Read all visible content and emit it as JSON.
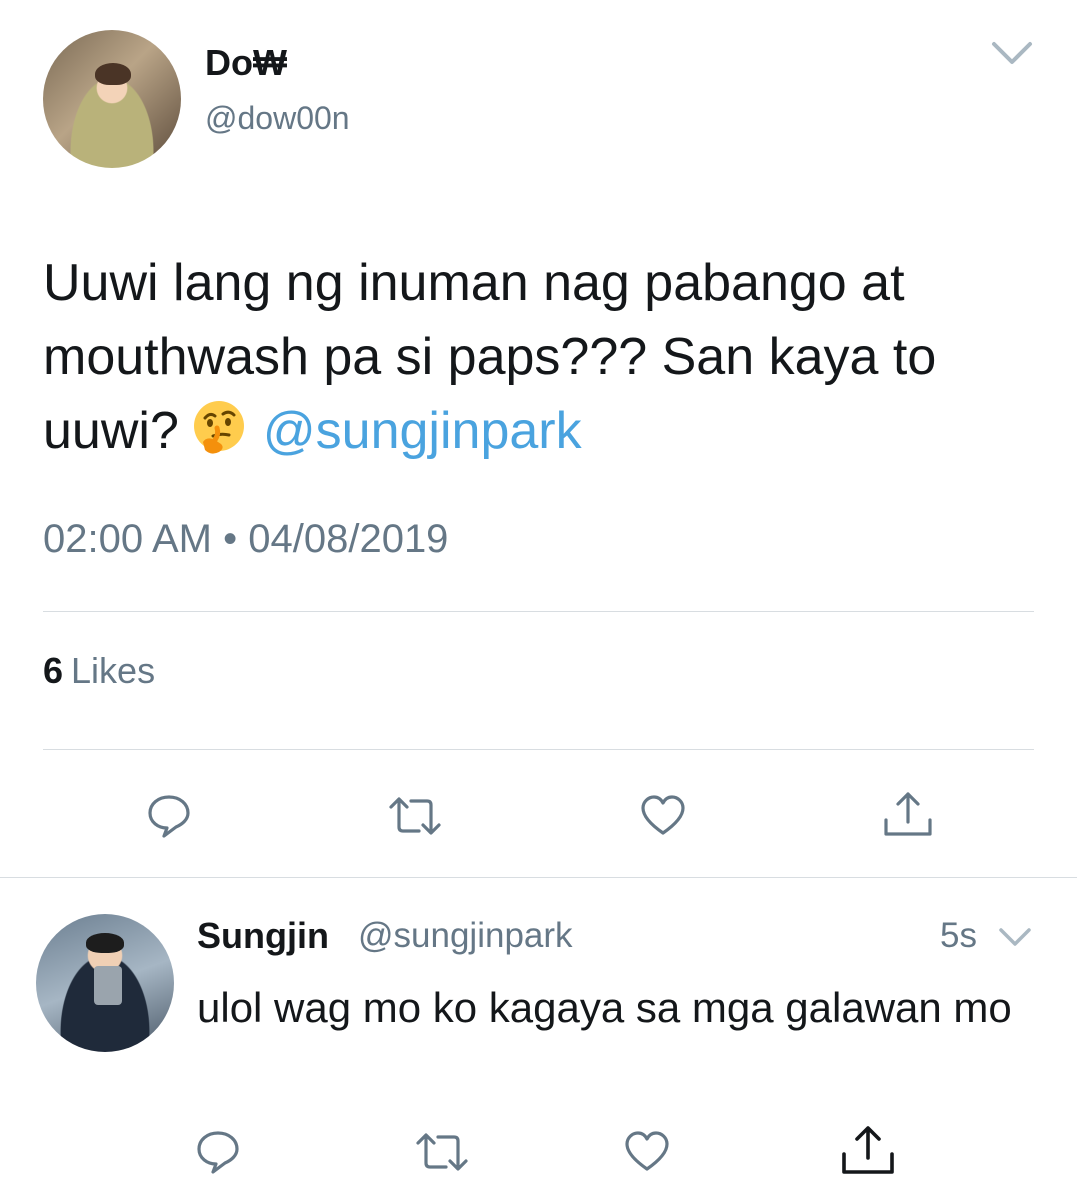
{
  "main_tweet": {
    "display_name": "Do₩",
    "handle": "@dow00n",
    "text_before_emoji": "Uuwi lang ng inuman nag pabango at mouthwash pa si paps??? San kaya to uuwi?",
    "emoji": "thinking-face",
    "mention": "@sungjinpark",
    "timestamp": "02:00 AM • 04/08/2019",
    "likes_count": "6",
    "likes_label": "Likes"
  },
  "reply_tweet": {
    "display_name": "Sungjin",
    "handle": "@sungjinpark",
    "time": "5s",
    "text": "ulol wag mo ko kagaya sa mga galawan mo"
  },
  "colors": {
    "text": "#14171a",
    "secondary": "#657786",
    "mention": "#4aa3df",
    "divider": "#d8dde1",
    "icon": "#657786"
  }
}
